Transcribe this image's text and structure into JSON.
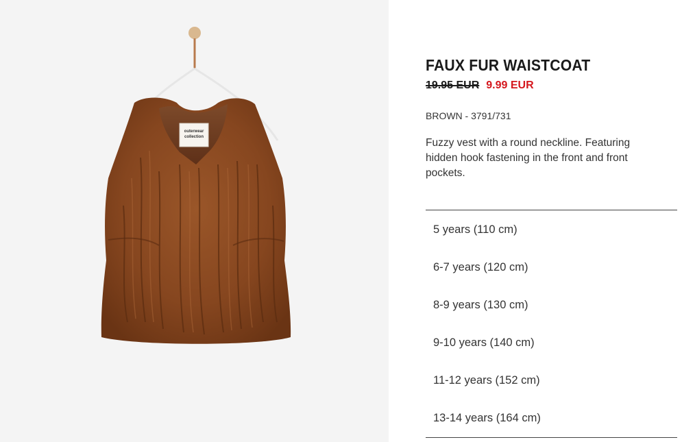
{
  "product": {
    "name": "FAUX FUR WAISTCOAT",
    "old_price": "19.95 EUR",
    "sale_price": "9.99 EUR",
    "color_ref": "BROWN - 3791/731",
    "description": "Fuzzy vest with a round neckline. Featuring hidden hook fastening in the front and front pockets.",
    "label_tag": {
      "line1": "outerwear",
      "line2": "collection"
    }
  },
  "sizes": [
    "5 years (110 cm)",
    "6-7 years (120 cm)",
    "8-9 years (130 cm)",
    "9-10 years (140 cm)",
    "11-12 years (152 cm)",
    "13-14 years (164 cm)"
  ],
  "colors": {
    "sale_red": "#d5171d",
    "text_dark": "#1a1a1a",
    "image_bg": "#f4f4f4",
    "fur_brown": "#8a4a22"
  }
}
